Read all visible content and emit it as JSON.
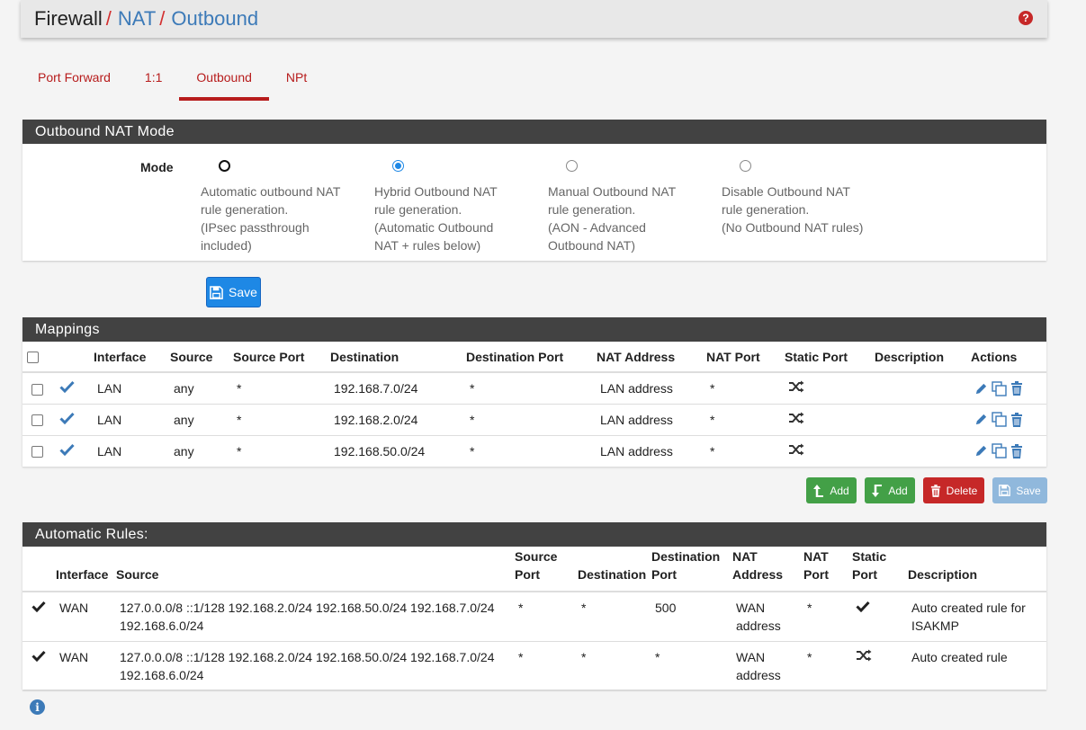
{
  "breadcrumb": {
    "root": "Firewall",
    "items": [
      "NAT",
      "Outbound"
    ],
    "separator": "/"
  },
  "tabs": [
    "Port Forward",
    "1:1",
    "Outbound",
    "NPt"
  ],
  "active_tab": "Outbound",
  "mode_panel": {
    "title": "Outbound NAT Mode",
    "mode_label": "Mode",
    "options": [
      {
        "lines": [
          "Automatic outbound NAT",
          "rule generation.",
          "(IPsec passthrough",
          "included)"
        ],
        "state": "focused"
      },
      {
        "lines": [
          "Hybrid Outbound NAT",
          "rule generation.",
          "(Automatic Outbound",
          "NAT + rules below)"
        ],
        "state": "checked"
      },
      {
        "lines": [
          "Manual Outbound NAT",
          "rule generation.",
          "(AON - Advanced",
          "Outbound NAT)"
        ],
        "state": "unchecked"
      },
      {
        "lines": [
          "Disable Outbound NAT",
          "rule generation.",
          "(No Outbound NAT rules)"
        ],
        "state": "unchecked"
      }
    ],
    "save_label": "Save"
  },
  "mappings": {
    "title": "Mappings",
    "columns": [
      "Interface",
      "Source",
      "Source Port",
      "Destination",
      "Destination Port",
      "NAT Address",
      "NAT Port",
      "Static Port",
      "Description",
      "Actions"
    ],
    "rows": [
      {
        "interface": "LAN",
        "source": "any",
        "source_port": "*",
        "destination": "192.168.7.0/24",
        "destination_port": "*",
        "nat_address": "LAN address",
        "nat_port": "*",
        "description": ""
      },
      {
        "interface": "LAN",
        "source": "any",
        "source_port": "*",
        "destination": "192.168.2.0/24",
        "destination_port": "*",
        "nat_address": "LAN address",
        "nat_port": "*",
        "description": ""
      },
      {
        "interface": "LAN",
        "source": "any",
        "source_port": "*",
        "destination": "192.168.50.0/24",
        "destination_port": "*",
        "nat_address": "LAN address",
        "nat_port": "*",
        "description": ""
      }
    ],
    "buttons": {
      "add_top": "Add",
      "add_bottom": "Add",
      "delete": "Delete",
      "save": "Save"
    }
  },
  "auto_rules": {
    "title": "Automatic Rules:",
    "columns": {
      "interface": "Interface",
      "source": "Source",
      "source_port": [
        "Source",
        "Port"
      ],
      "destination": "Destination",
      "destination_port": [
        "Destination",
        "Port"
      ],
      "nat_address": [
        "NAT",
        "Address"
      ],
      "nat_port": [
        "NAT",
        "Port"
      ],
      "static_port": [
        "Static",
        "Port"
      ],
      "description": "Description"
    },
    "rows": [
      {
        "interface": "WAN",
        "source": [
          "127.0.0.0/8 ::1/128 192.168.2.0/24 192.168.50.0/24 192.168.7.0/24",
          "192.168.6.0/24"
        ],
        "source_port": "*",
        "destination": "*",
        "destination_port": "500",
        "nat_address": [
          "WAN",
          "address"
        ],
        "nat_port": "*",
        "static_icon": "check-icon",
        "description": [
          "Auto created rule for",
          "ISAKMP"
        ]
      },
      {
        "interface": "WAN",
        "source": [
          "127.0.0.0/8 ::1/128 192.168.2.0/24 192.168.50.0/24 192.168.7.0/24",
          "192.168.6.0/24"
        ],
        "source_port": "*",
        "destination": "*",
        "destination_port": "*",
        "nat_address": [
          "WAN",
          "address"
        ],
        "nat_port": "*",
        "static_icon": "shuffle-icon",
        "description": [
          "Auto created rule"
        ]
      }
    ]
  },
  "colors": {
    "accent_red": "#b71c1c",
    "link_blue": "#3c7ab8",
    "panel_header": "#424242",
    "success_green": "#43a047",
    "danger_red": "#c62828",
    "primary_blue": "#1e88e5"
  }
}
